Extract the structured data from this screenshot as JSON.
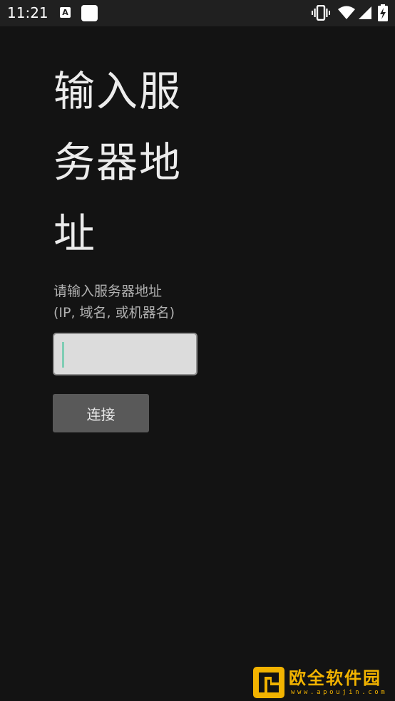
{
  "status_bar": {
    "time": "11:21",
    "notification_icons": [
      "text-a-icon",
      "square-app-icon"
    ],
    "system_icons": [
      "vibrate-icon",
      "wifi-icon",
      "signal-icon",
      "battery-charging-icon"
    ]
  },
  "main": {
    "title": "输入服务器地址",
    "prompt_line1": "请输入服务器地址",
    "prompt_line2": "(IP, 域名, 或机器名)",
    "address_input": {
      "value": "",
      "placeholder": ""
    },
    "connect_button_label": "连接"
  },
  "watermark": {
    "name": "欧全软件园",
    "url": "www.apoujin.com"
  },
  "colors": {
    "background": "#131313",
    "status_bar": "#202020",
    "button": "#595959",
    "input_background": "#dcdcdc",
    "cursor": "#7fcdb4",
    "watermark": "#f2b300"
  }
}
